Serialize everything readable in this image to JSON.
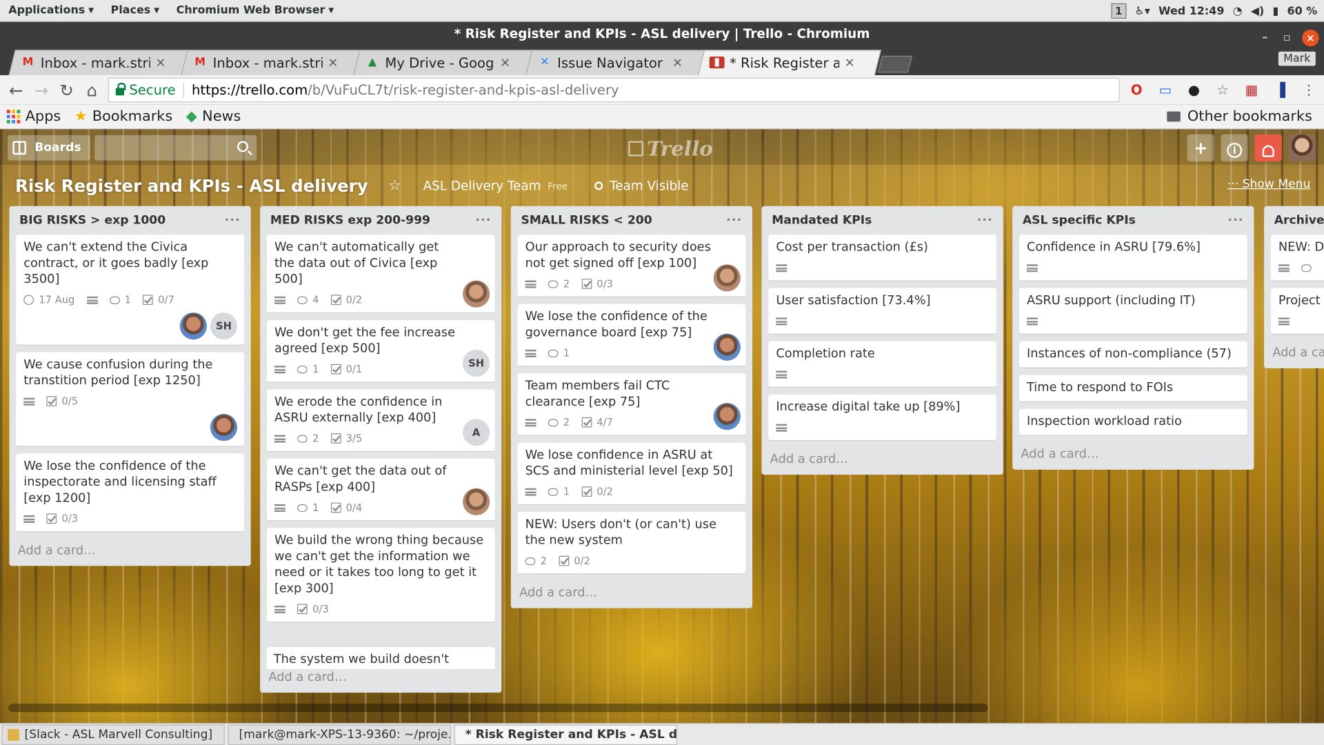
{
  "gnome": {
    "applications": "Applications",
    "places": "Places",
    "browser_menu": "Chromium Web Browser",
    "workspace": "1",
    "clock": "Wed 12:49",
    "battery": "60 %"
  },
  "window": {
    "title": "* Risk Register and KPIs - ASL delivery | Trello - Chromium",
    "close_glyph": "×",
    "min_glyph": "–",
    "max_glyph": "▫"
  },
  "tabs": [
    {
      "title": "Inbox - mark.strin",
      "icon": "gmail-icon"
    },
    {
      "title": "Inbox - mark.strin",
      "icon": "gmail-icon"
    },
    {
      "title": "My Drive - Google",
      "icon": "drive-icon"
    },
    {
      "title": "Issue Navigator -",
      "icon": "jira-icon"
    },
    {
      "title": "* Risk Register an",
      "icon": "trello-icon"
    }
  ],
  "profile_name": "Mark",
  "address": {
    "secure_label": "Secure",
    "url_host": "https://trello.com",
    "url_path": "/b/VuFuCL7t/risk-register-and-kpis-asl-delivery"
  },
  "bookmarks": {
    "apps": "Apps",
    "bookmarks": "Bookmarks",
    "news": "News",
    "other": "Other bookmarks"
  },
  "trello": {
    "boards_label": "Boards",
    "logo_text": "Trello",
    "board_title": "Risk Register and KPIs - ASL delivery",
    "team_name": "ASL Delivery Team",
    "team_plan": "Free",
    "visibility": "Team Visible",
    "show_menu": "Show Menu",
    "add_card": "Add a card…"
  },
  "lists": [
    {
      "title": "BIG RISKS > exp 1000",
      "cards": [
        {
          "title": "We can't extend the Civica contract, or it goes badly [exp 3500]",
          "due": "17 Aug",
          "comments": "1",
          "checklist": "0/7",
          "avatars": [
            "photo",
            "SH"
          ]
        },
        {
          "title": "We cause confusion during the transtition period [exp 1250]",
          "checklist": "0/5",
          "avatars": [
            "photo"
          ]
        },
        {
          "title": "We lose the confidence of the inspectorate and licensing staff [exp 1200]",
          "checklist": "0/3"
        }
      ]
    },
    {
      "title": "MED RISKS exp 200-999",
      "cards": [
        {
          "title": "We can't automatically get the data out of Civica [exp 500]",
          "comments": "4",
          "checklist": "0/2",
          "avatars": [
            "photo2"
          ]
        },
        {
          "title": "We don't get the fee increase agreed [exp 500]",
          "comments": "1",
          "checklist": "0/1",
          "avatars": [
            "SH"
          ]
        },
        {
          "title": "We erode the confidence in ASRU externally [exp 400]",
          "comments": "2",
          "checklist": "3/5",
          "avatars": [
            "A"
          ]
        },
        {
          "title": "We can't get the data out of RASPs [exp 400]",
          "comments": "1",
          "checklist": "0/4",
          "avatars": [
            "photo2"
          ]
        },
        {
          "title": "We build the wrong thing because we can't get the information we need or it takes too long to get it [exp 300]",
          "checklist": "0/3"
        }
      ],
      "peek": "The system we build doesn't reflect"
    },
    {
      "title": "SMALL RISKS < 200",
      "cards": [
        {
          "title": "Our approach to security does not get signed off [exp 100]",
          "comments": "2",
          "checklist": "0/3",
          "avatars": [
            "photo2"
          ]
        },
        {
          "title": "We lose the confidence of the governance board [exp 75]",
          "comments": "1",
          "avatars": [
            "photo"
          ]
        },
        {
          "title": "Team members fail CTC clearance [exp 75]",
          "comments": "2",
          "checklist": "4/7",
          "avatars": [
            "photo"
          ]
        },
        {
          "title": "We lose confidence in ASRU at SCS and ministerial level [exp 50]",
          "comments": "1",
          "checklist": "0/2"
        },
        {
          "title": "NEW: Users don't (or can't) use the new system",
          "comments": "2",
          "checklist": "0/2"
        }
      ]
    },
    {
      "title": "Mandated KPIs",
      "cards": [
        {
          "title": "Cost per transaction (£s)"
        },
        {
          "title": "User satisfaction [73.4%]"
        },
        {
          "title": "Completion rate"
        },
        {
          "title": "Increase digital take up [89%]"
        }
      ]
    },
    {
      "title": "ASL specific KPIs",
      "cards": [
        {
          "title": "Confidence in ASRU [79.6%]"
        },
        {
          "title": "ASRU support (including IT)"
        },
        {
          "title": "Instances of non-compliance (57)"
        },
        {
          "title": "Time to respond to FOIs"
        },
        {
          "title": "Inspection workload ratio"
        }
      ]
    },
    {
      "title": "Archive",
      "cards": [
        {
          "title": "NEW: D"
        },
        {
          "title": "Project l"
        }
      ],
      "add_card": "Add a ca"
    }
  ],
  "taskbar": [
    {
      "label": "[Slack - ASL Marvell Consulting]"
    },
    {
      "label": "[mark@mark-XPS-13-9360: ~/proje..."
    },
    {
      "label": "* Risk Register and KPIs - ASL deliv..."
    }
  ]
}
